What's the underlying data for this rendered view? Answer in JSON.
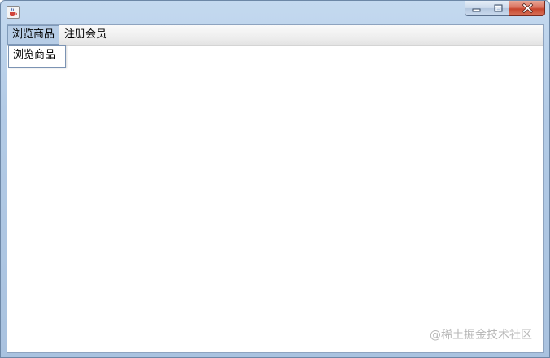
{
  "window": {
    "app_icon": "java-cup-icon",
    "buttons": {
      "minimize": "minimize-icon",
      "maximize": "maximize-icon",
      "close": "close-icon"
    }
  },
  "menubar": {
    "menus": [
      {
        "label": "浏览商品",
        "active": true
      },
      {
        "label": "注册会员",
        "active": false
      }
    ]
  },
  "dropdown": {
    "items": [
      {
        "label": "浏览商品"
      }
    ]
  },
  "watermark": "@稀土掘金技术社区",
  "colors": {
    "title_bar": "#b3cbe6",
    "close_button": "#c7442c",
    "menu_highlight": "#b7cde6"
  }
}
